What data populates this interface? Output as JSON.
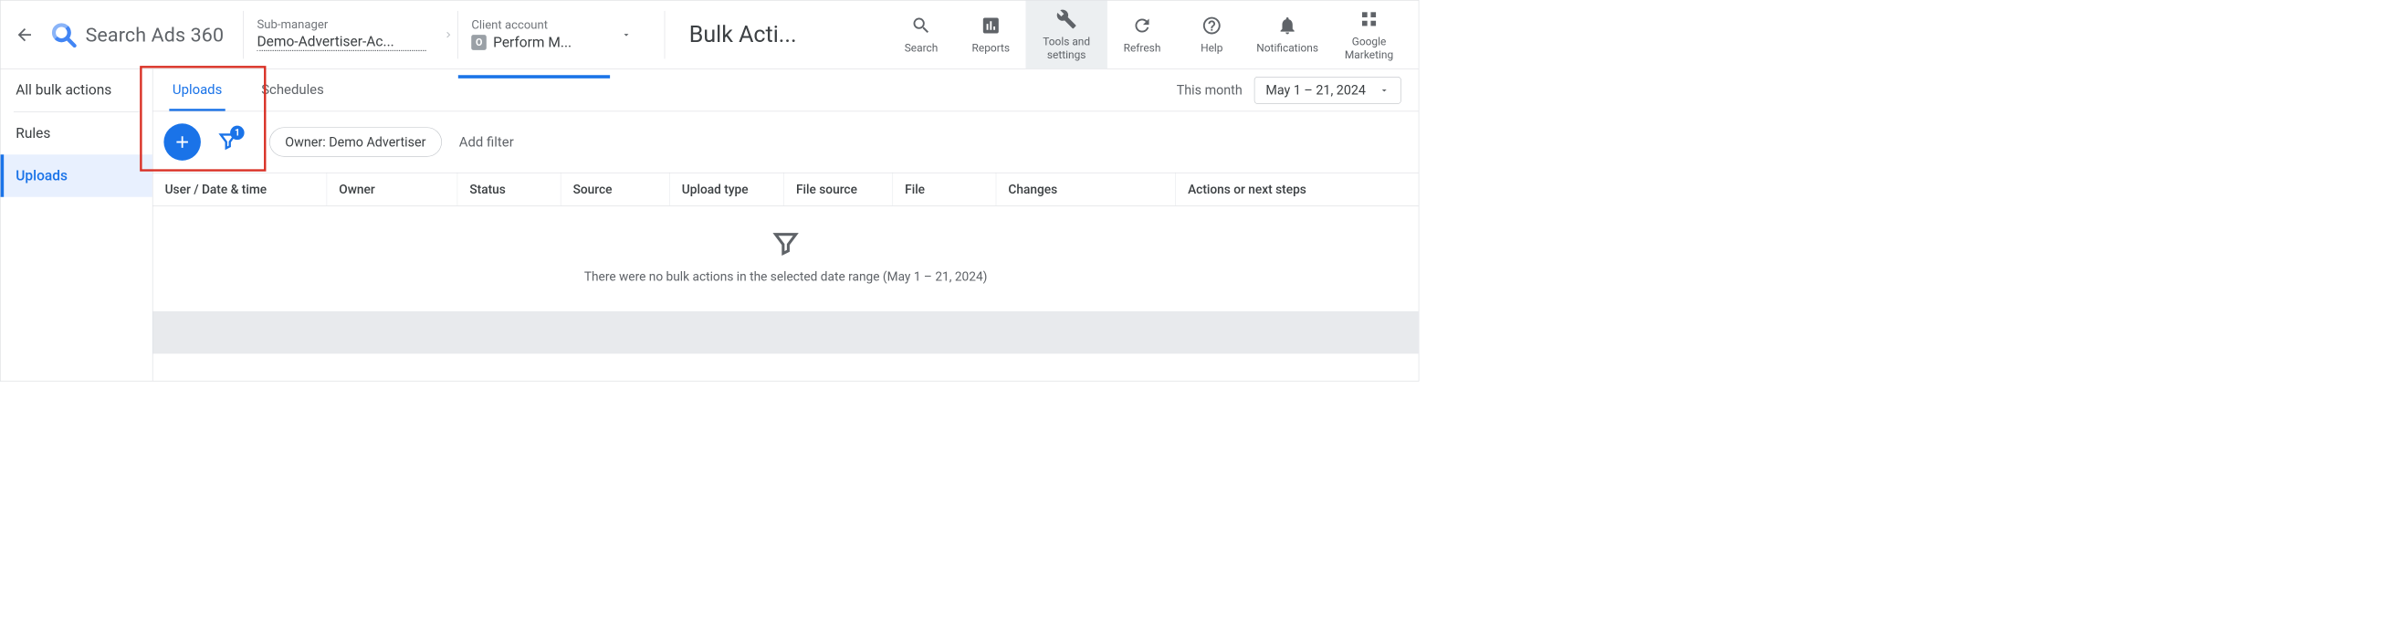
{
  "header": {
    "app_name": "Search Ads 360",
    "breadcrumbs": {
      "sub_manager_label": "Sub-manager",
      "sub_manager_value": "Demo-Advertiser-Ac...",
      "client_label": "Client account",
      "client_value": "Perform M...",
      "client_badge": "O"
    },
    "page_title": "Bulk Acti...",
    "actions": {
      "search": "Search",
      "reports": "Reports",
      "tools": "Tools and settings",
      "refresh": "Refresh",
      "help": "Help",
      "notifications": "Notifications",
      "marketing": "Google Marketing"
    }
  },
  "sidebar": {
    "items": [
      "All bulk actions",
      "Rules",
      "Uploads"
    ],
    "selected_index": 2
  },
  "tabs": {
    "items": [
      "Uploads",
      "Schedules"
    ],
    "selected_index": 0
  },
  "date": {
    "preset": "This month",
    "range": "May 1 – 21, 2024"
  },
  "toolbar": {
    "filter_count": "1",
    "chip": "Owner: Demo Advertiser",
    "add_filter": "Add filter"
  },
  "table": {
    "columns": [
      "User / Date & time",
      "Owner",
      "Status",
      "Source",
      "Upload type",
      "File source",
      "File",
      "Changes",
      "Actions or next steps"
    ]
  },
  "empty": {
    "message": "There were no bulk actions in the selected date range (May 1 – 21, 2024)"
  }
}
